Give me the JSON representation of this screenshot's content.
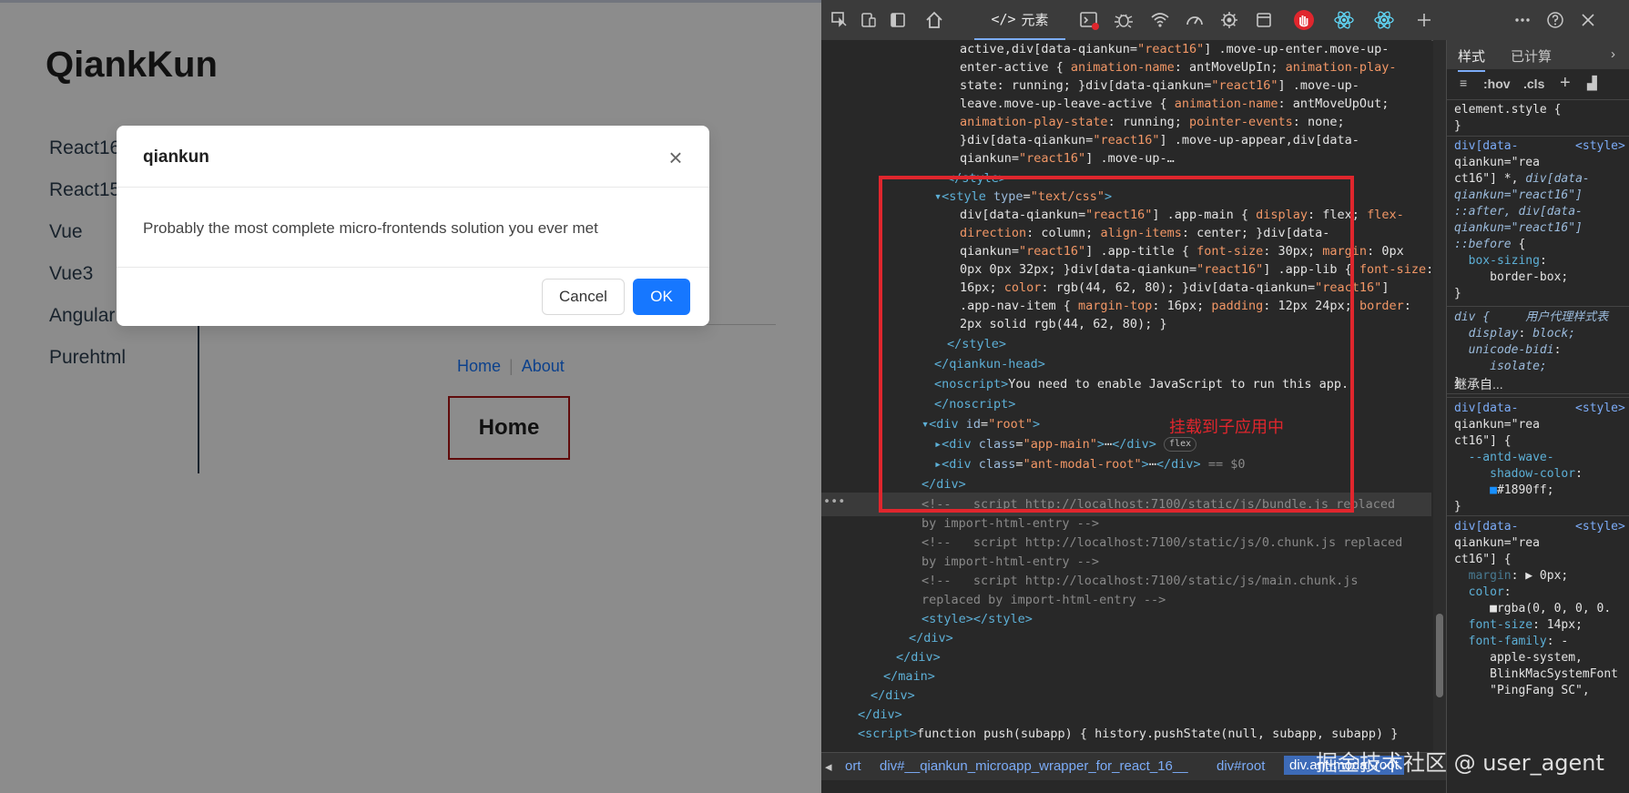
{
  "page": {
    "title": "QiankKun",
    "nav": [
      "React16",
      "React15",
      "Vue",
      "Vue3",
      "Angular",
      "Purehtml"
    ],
    "sub_links": {
      "home": "Home",
      "about": "About",
      "separator": "|"
    },
    "sub_heading": "Home"
  },
  "modal": {
    "title": "qiankun",
    "close_glyph": "×",
    "body": "Probably the most complete micro-frontends solution you ever met",
    "cancel": "Cancel",
    "ok": "OK"
  },
  "devtools": {
    "tab_elements": "元素",
    "tab_elements_icon": "</>",
    "annotation": "挂载到子应用中",
    "breadcrumbs": [
      "ort",
      "div#__qiankun_microapp_wrapper_for_react_16__",
      "div#root",
      "div.ant-modal-root"
    ],
    "styles_tabs": [
      "样式",
      "已计算"
    ],
    "styles_filter": [
      ":hov",
      ".cls",
      "+"
    ],
    "inherited_label": "继承自...",
    "watermark": "掘金技术社区 @ user_agent",
    "flex_badge": "flex",
    "dollar0": "== $0"
  }
}
